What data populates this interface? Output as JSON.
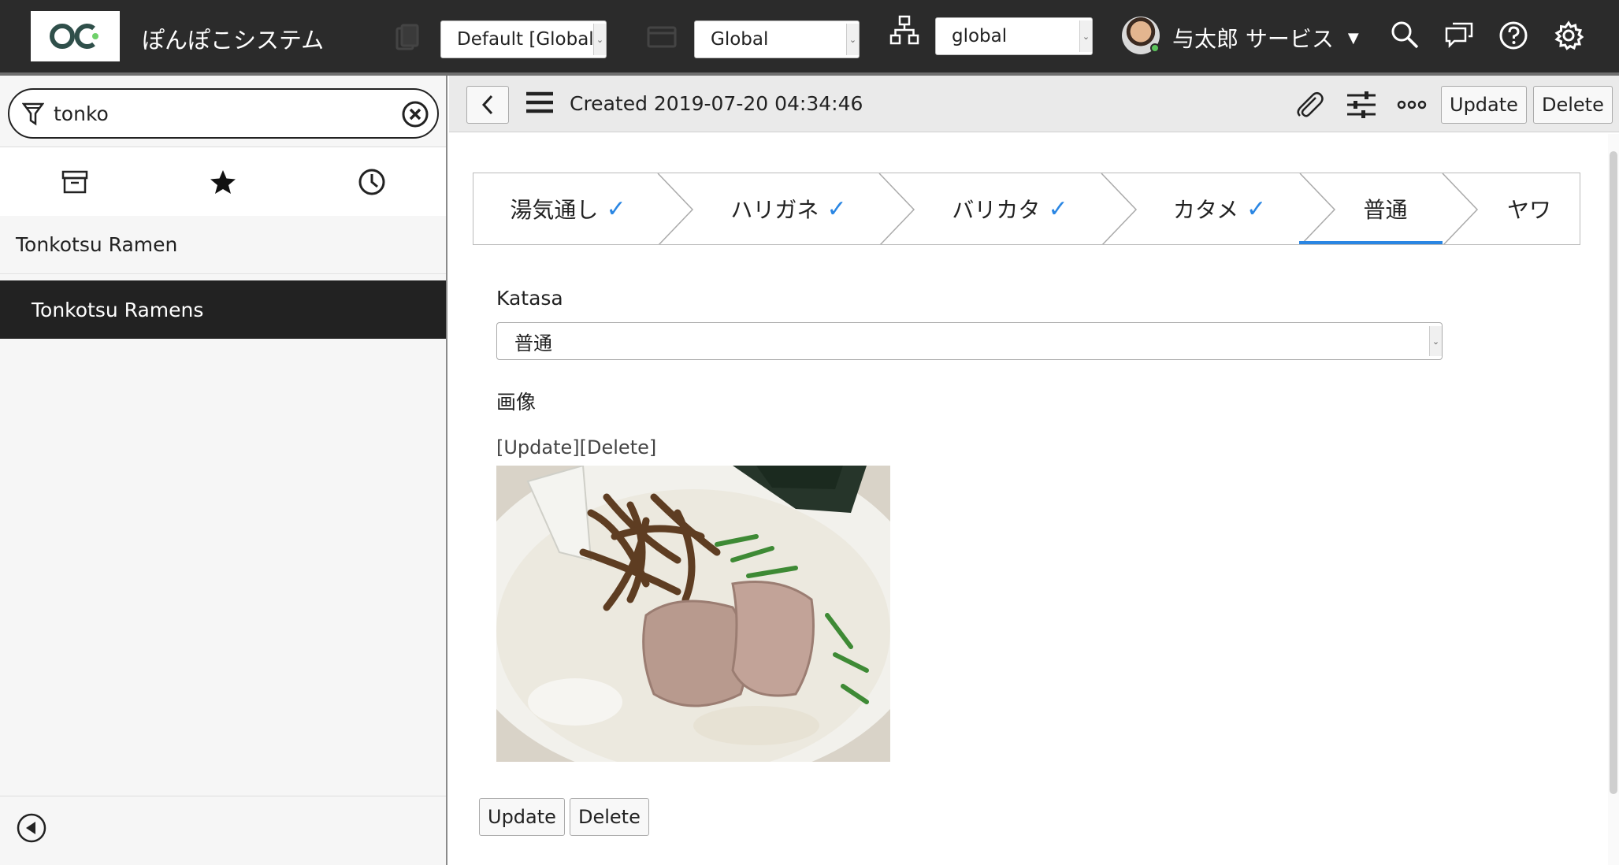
{
  "header": {
    "app_name": "ぽんぽこシステム",
    "domain_select": "Default [Global]",
    "scope_select": "Global",
    "update_set_select": "global",
    "user_name": "与太郎 サービス",
    "icons": [
      "logo",
      "document-icon",
      "window-icon",
      "hierarchy-icon",
      "search-icon",
      "chat-icon",
      "help-icon",
      "gear-icon"
    ]
  },
  "sidebar": {
    "filter_value": "tonko",
    "tabs": [
      "archive-icon",
      "star-icon",
      "clock-icon"
    ],
    "items": [
      {
        "label": "Tonkotsu Ramen",
        "active": false
      },
      {
        "label": "Tonkotsu Ramens",
        "active": true
      }
    ]
  },
  "toolbar": {
    "title": "Created 2019-07-20 04:34:46",
    "update_label": "Update",
    "delete_label": "Delete"
  },
  "steps": [
    {
      "label": "湯気通し",
      "done": true
    },
    {
      "label": "ハリガネ",
      "done": true
    },
    {
      "label": "バリカタ",
      "done": true
    },
    {
      "label": "カタメ",
      "done": true
    },
    {
      "label": "普通",
      "done": false,
      "current": true
    },
    {
      "label": "ヤワ",
      "done": false
    }
  ],
  "form": {
    "katasa_label": "Katasa",
    "katasa_value": "普通",
    "image_label": "画像",
    "image_update_link": "[Update]",
    "image_delete_link": "[Delete]",
    "update_label": "Update",
    "delete_label": "Delete"
  },
  "colors": {
    "header_bg": "#2b2b2b",
    "accent": "#2a86e3",
    "active_item_bg": "#222222"
  }
}
